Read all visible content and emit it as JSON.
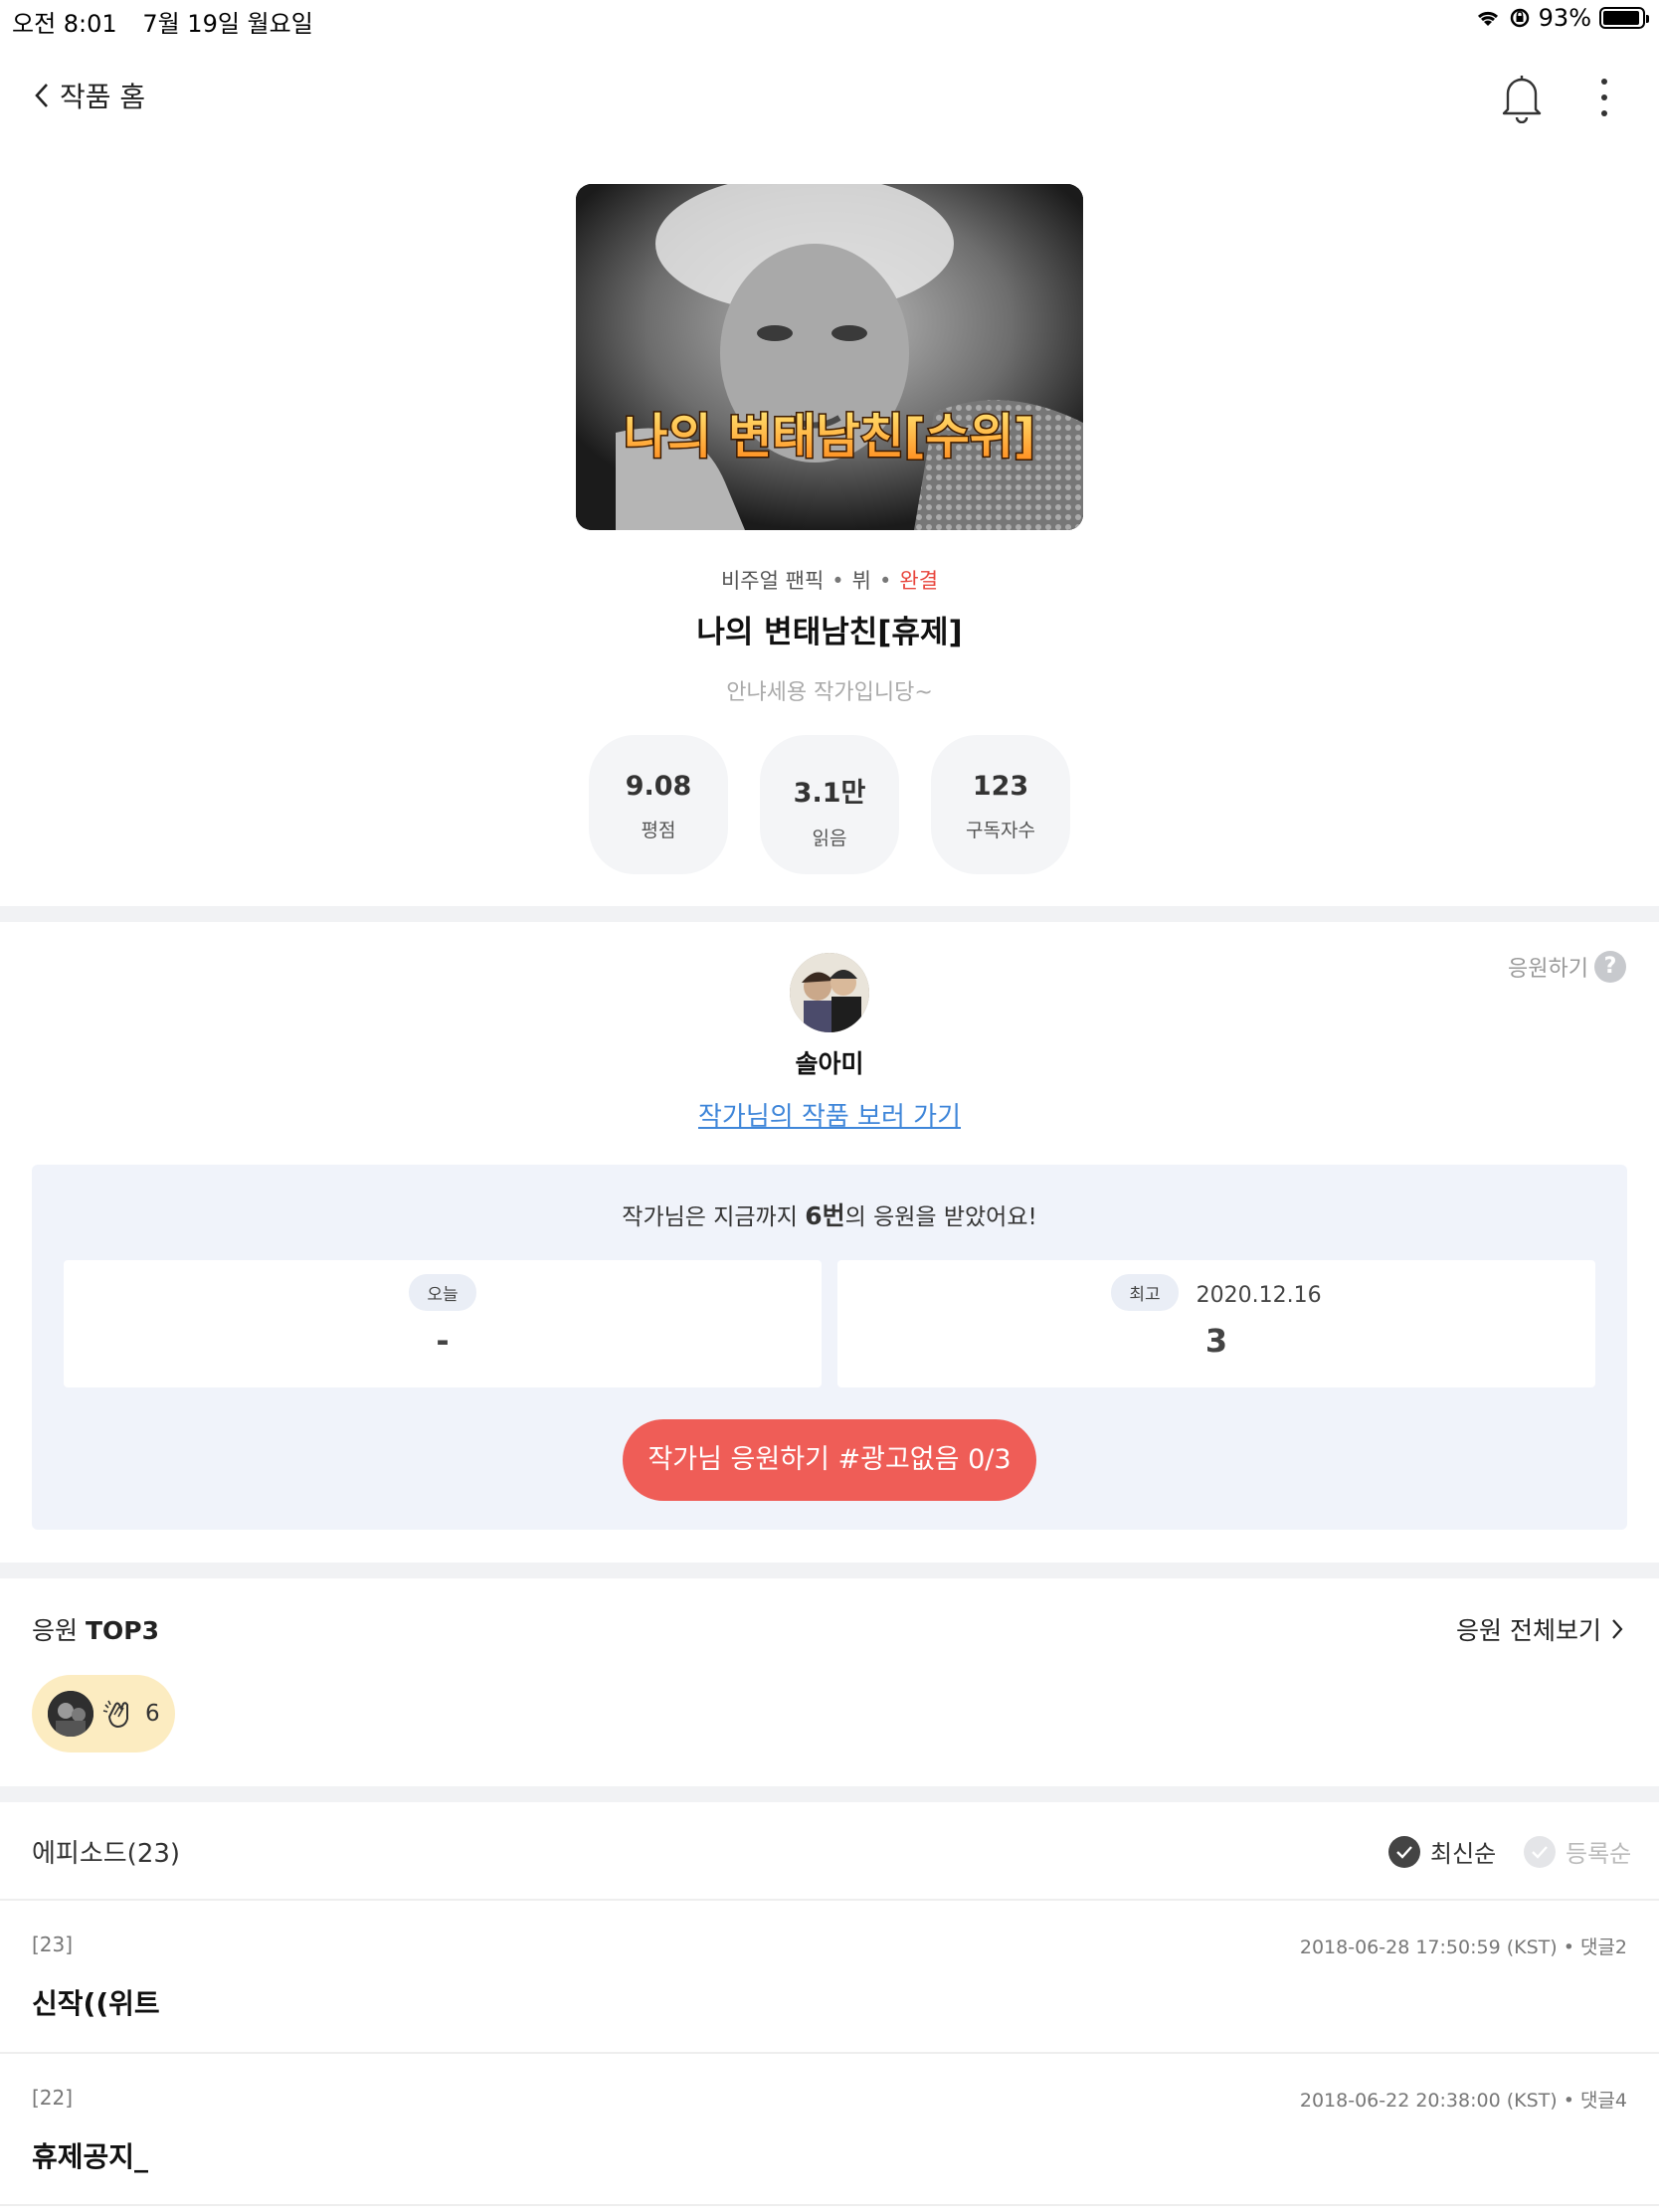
{
  "status_bar": {
    "time": "오전 8:01",
    "date": "7월 19일 월요일",
    "battery": "93%"
  },
  "nav": {
    "back_label": "작품 홈"
  },
  "work": {
    "cover_text": "나의 변태남친[수위]",
    "genre": "비주얼 팬픽",
    "tag": "뷔",
    "status": "완결",
    "title": "나의 변태남친[휴제]",
    "description": "안냐세용 작가입니당~",
    "stats": [
      {
        "value": "9.08",
        "label": "평점"
      },
      {
        "value": "3.1만",
        "label": "읽음"
      },
      {
        "value": "123",
        "label": "구독자수"
      }
    ]
  },
  "author": {
    "cheer_help_label": "응원하기",
    "name": "솔아미",
    "works_link": "작가님의 작품 보러 가기",
    "cheer_summary_prefix": "작가님은 지금까지 ",
    "cheer_summary_count": "6번",
    "cheer_summary_suffix": "의 응원을 받았어요!",
    "today_label": "오늘",
    "today_value": "-",
    "best_label": "최고",
    "best_date": "2020.12.16",
    "best_value": "3",
    "cheer_button": "작가님 응원하기 #광고없음 0/3"
  },
  "top3": {
    "title_prefix": "응원 ",
    "title_bold": "TOP3",
    "view_all": "응원 전체보기",
    "entries": [
      {
        "count": "6"
      }
    ]
  },
  "episodes": {
    "header": "에피소드(23)",
    "sort_latest": "최신순",
    "sort_registered": "등록순",
    "items": [
      {
        "num": "[23]",
        "meta": "2018-06-28 17:50:59 (KST) • 댓글2",
        "title": "신작((위트"
      },
      {
        "num": "[22]",
        "meta": "2018-06-22 20:38:00 (KST) • 댓글4",
        "title": "휴제공지_"
      }
    ]
  },
  "colors": {
    "accent_red": "#ef5d57",
    "link_blue": "#3f86d9",
    "status_red": "#e8453c",
    "chip_yellow": "#fcecc1"
  }
}
